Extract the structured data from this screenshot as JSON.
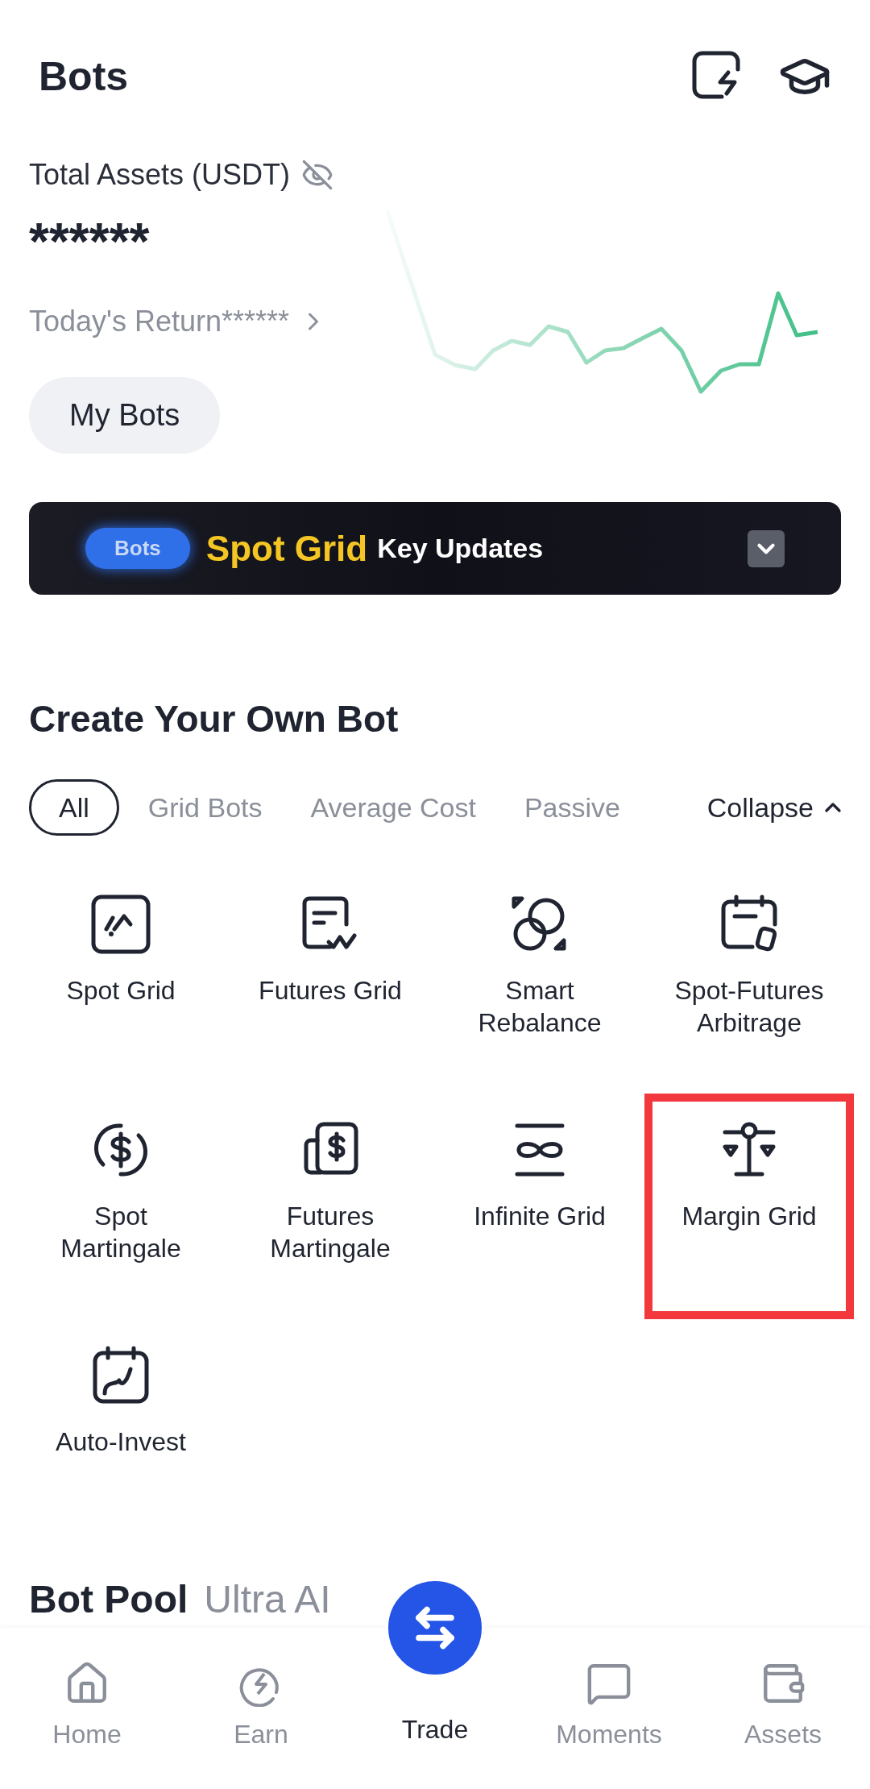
{
  "header": {
    "title": "Bots"
  },
  "assets": {
    "label": "Total Assets (USDT)",
    "value": "******",
    "return_label": "Today's Return******"
  },
  "my_bots_button": "My Bots",
  "banner": {
    "tag": "Bots",
    "highlight": "Spot Grid",
    "text": "Key Updates"
  },
  "create_section": {
    "title": "Create Your Own Bot",
    "tabs": [
      {
        "label": "All",
        "selected": true
      },
      {
        "label": "Grid Bots",
        "selected": false
      },
      {
        "label": "Average Cost",
        "selected": false
      },
      {
        "label": "Passive",
        "selected": false
      }
    ],
    "collapse": "Collapse",
    "bots": [
      {
        "kind": "spot-grid",
        "label": "Spot Grid",
        "highlighted": false
      },
      {
        "kind": "futures-grid",
        "label": "Futures Grid",
        "highlighted": false
      },
      {
        "kind": "rebalance",
        "label": "Smart\nRebalance",
        "highlighted": false
      },
      {
        "kind": "arbitrage",
        "label": "Spot-Futures\nArbitrage",
        "highlighted": false
      },
      {
        "kind": "martingale",
        "label": "Spot\nMartingale",
        "highlighted": false
      },
      {
        "kind": "futures-martingale",
        "label": "Futures\nMartingale",
        "highlighted": false
      },
      {
        "kind": "infinite",
        "label": "Infinite Grid",
        "highlighted": false
      },
      {
        "kind": "margin",
        "label": "Margin Grid",
        "highlighted": true
      },
      {
        "kind": "auto-invest",
        "label": "Auto-Invest",
        "highlighted": false
      }
    ]
  },
  "bot_pool": {
    "title": "Bot Pool",
    "tab": "Ultra AI"
  },
  "nav": [
    {
      "kind": "home",
      "label": "Home",
      "selected": false
    },
    {
      "kind": "earn",
      "label": "Earn",
      "selected": false
    },
    {
      "kind": "trade",
      "label": "Trade",
      "selected": true
    },
    {
      "kind": "moments",
      "label": "Moments",
      "selected": false
    },
    {
      "kind": "assets",
      "label": "Assets",
      "selected": false
    }
  ]
}
